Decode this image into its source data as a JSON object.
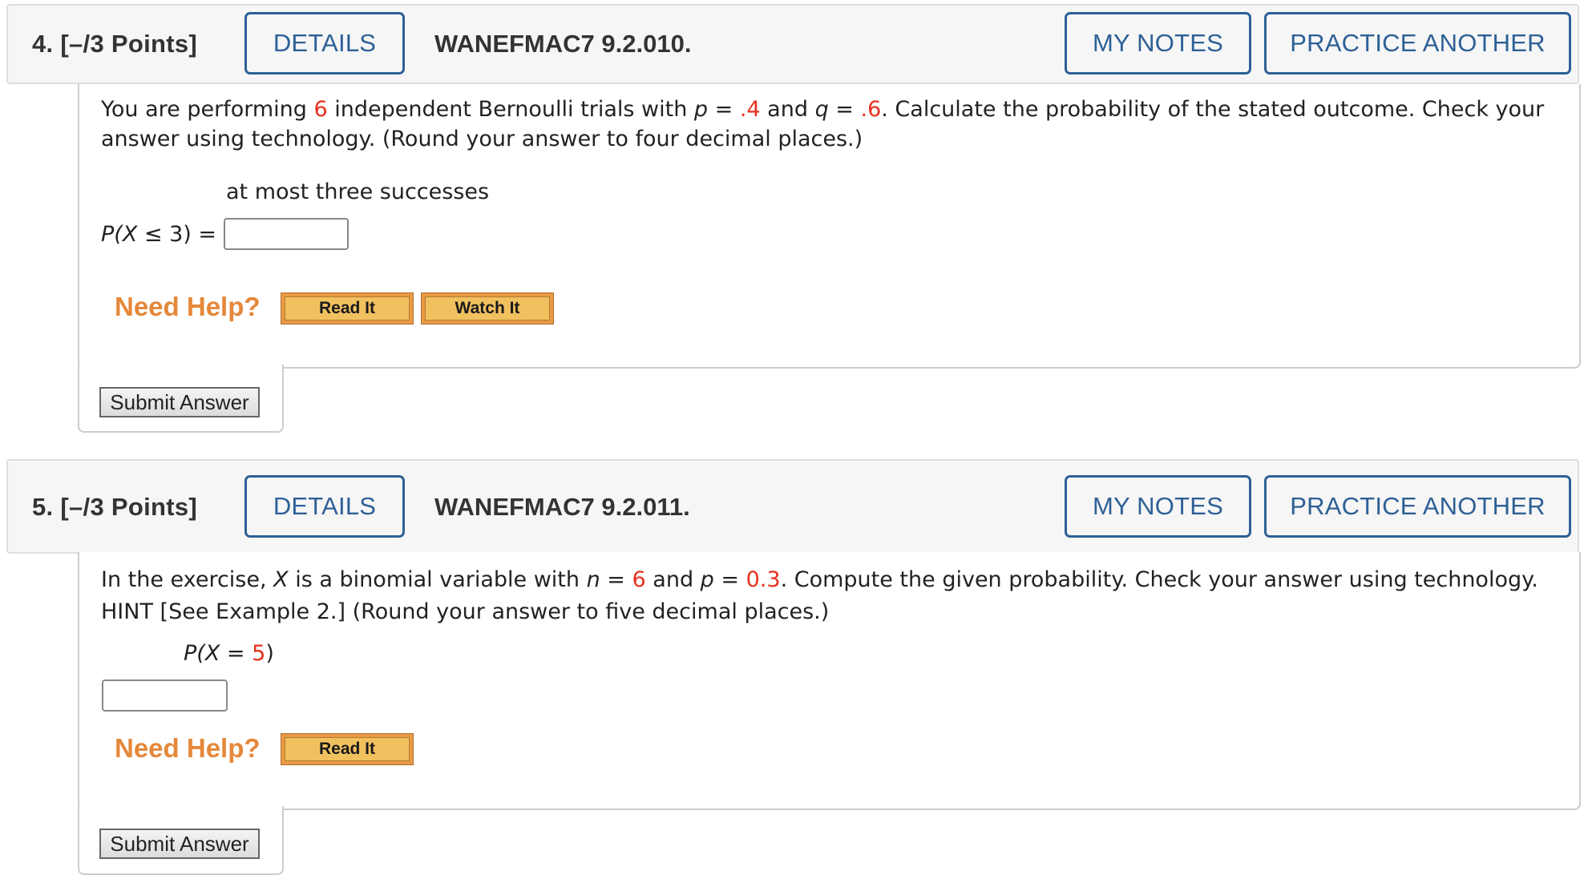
{
  "questions": [
    {
      "number_label": "4.  [–/3 Points]",
      "details_label": "DETAILS",
      "code": "WANEFMAC7 9.2.010.",
      "my_notes_label": "MY NOTES",
      "practice_label": "PRACTICE ANOTHER",
      "prompt": {
        "t1": "You are performing ",
        "n": "6",
        "t2": " independent Bernoulli trials with ",
        "pvar": "p",
        "t3": " = ",
        "pval": ".4",
        "t4": " and ",
        "qvar": "q",
        "t5": " = ",
        "qval": ".6",
        "t6": ". Calculate the probability of the stated outcome. Check your",
        "line2": "answer using technology. (Round your answer to four decimal places.)"
      },
      "outcome": "at most three successes",
      "expr": {
        "P": "P(",
        "X": "X",
        "rest": " ≤ 3) ="
      },
      "answer_value": "",
      "need_help": "Need Help?",
      "help_buttons": [
        "Read It",
        "Watch It"
      ],
      "submit_label": "Submit Answer"
    },
    {
      "number_label": "5.  [–/3 Points]",
      "details_label": "DETAILS",
      "code": "WANEFMAC7 9.2.011.",
      "my_notes_label": "MY NOTES",
      "practice_label": "PRACTICE ANOTHER",
      "prompt": {
        "t1": "In the exercise, ",
        "xvar": "X",
        "t2": " is a binomial variable with ",
        "nvar": "n",
        "t3": " = ",
        "nval": "6",
        "t4": " and ",
        "pvar": "p",
        "t5": " = ",
        "pval": "0.3",
        "t6": ". Compute the given probability. Check your answer using technology.",
        "line2": "HINT [See Example 2.] (Round your answer to five decimal places.)"
      },
      "expr": {
        "P": "P(",
        "X": "X",
        "eq": " = ",
        "val": "5",
        "close": ")"
      },
      "answer_value": "",
      "need_help": "Need Help?",
      "help_buttons": [
        "Read It"
      ],
      "submit_label": "Submit Answer"
    }
  ],
  "colors": {
    "accent": "#2d6096",
    "highlight": "#e8301f",
    "help": "#e5883a"
  }
}
